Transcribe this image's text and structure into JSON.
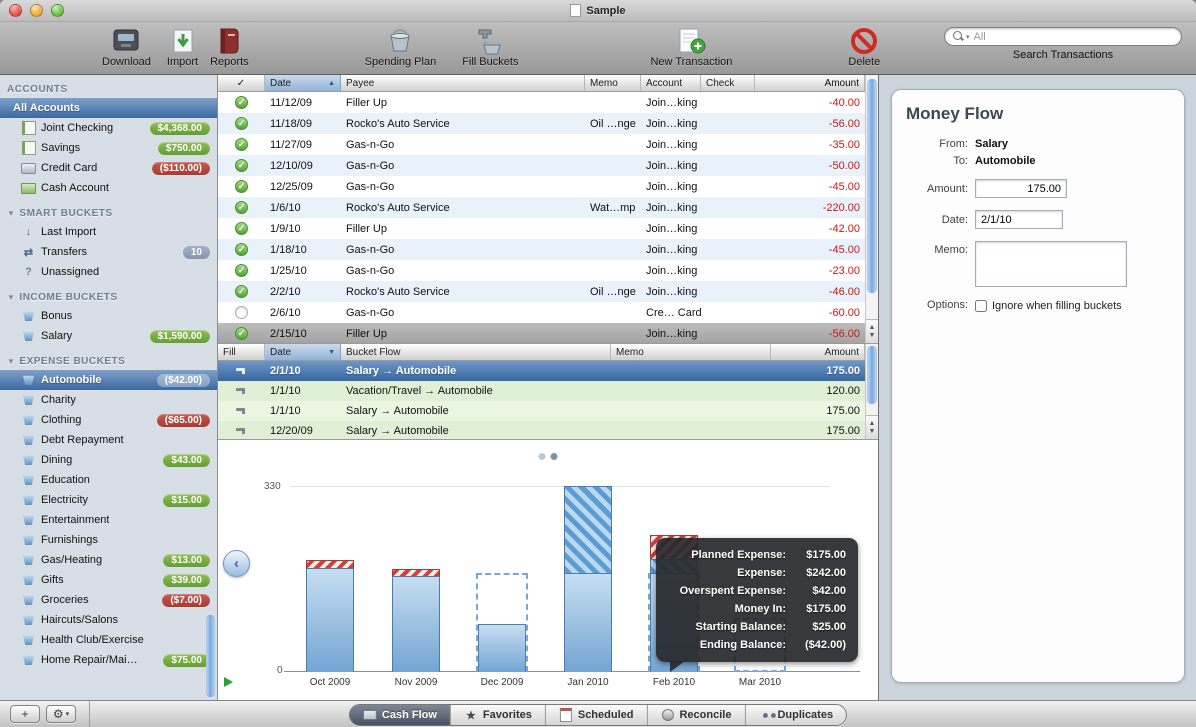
{
  "window": {
    "title": "Sample"
  },
  "toolbar": {
    "buttons": [
      {
        "label": "Download",
        "icon": "download-icon"
      },
      {
        "label": "Import",
        "icon": "import-icon"
      },
      {
        "label": "Reports",
        "icon": "reports-icon"
      },
      {
        "label": "Spending Plan",
        "icon": "spending-plan-icon"
      },
      {
        "label": "Fill Buckets",
        "icon": "fill-buckets-icon"
      },
      {
        "label": "New Transaction",
        "icon": "new-transaction-icon"
      },
      {
        "label": "Delete",
        "icon": "delete-icon"
      }
    ],
    "search": {
      "placeholder": "All",
      "label": "Search Transactions"
    }
  },
  "sidebar": {
    "sections": [
      {
        "title": "ACCOUNTS",
        "disclosure": false,
        "items": [
          {
            "label": "All Accounts",
            "selected": true
          },
          {
            "label": "Joint Checking",
            "icon": "account-icon",
            "badge": "$4,368.00",
            "badge_color": "green"
          },
          {
            "label": "Savings",
            "icon": "account-icon",
            "badge": "$750.00",
            "badge_color": "green"
          },
          {
            "label": "Credit Card",
            "icon": "card-icon",
            "badge": "($110.00)",
            "badge_color": "red"
          },
          {
            "label": "Cash Account",
            "icon": "cash-icon"
          }
        ]
      },
      {
        "title": "SMART BUCKETS",
        "disclosure": true,
        "items": [
          {
            "label": "Last Import",
            "icon": "import-bucket-icon"
          },
          {
            "label": "Transfers",
            "icon": "transfer-icon",
            "badge": "10",
            "badge_color": "gray"
          },
          {
            "label": "Unassigned",
            "icon": "unassigned-icon"
          }
        ]
      },
      {
        "title": "INCOME BUCKETS",
        "disclosure": true,
        "items": [
          {
            "label": "Bonus",
            "icon": "bucket-icon"
          },
          {
            "label": "Salary",
            "icon": "bucket-icon",
            "badge": "$1,590.00",
            "badge_color": "green"
          }
        ]
      },
      {
        "title": "EXPENSE BUCKETS",
        "disclosure": true,
        "items": [
          {
            "label": "Automobile",
            "icon": "bucket-icon",
            "selected": true,
            "badge": "($42.00)",
            "badge_color": "white"
          },
          {
            "label": "Charity",
            "icon": "bucket-icon"
          },
          {
            "label": "Clothing",
            "icon": "bucket-icon",
            "badge": "($65.00)",
            "badge_color": "red"
          },
          {
            "label": "Debt Repayment",
            "icon": "bucket-icon"
          },
          {
            "label": "Dining",
            "icon": "bucket-icon",
            "badge": "$43.00",
            "badge_color": "green"
          },
          {
            "label": "Education",
            "icon": "bucket-icon"
          },
          {
            "label": "Electricity",
            "icon": "bucket-icon",
            "badge": "$15.00",
            "badge_color": "green"
          },
          {
            "label": "Entertainment",
            "icon": "bucket-icon"
          },
          {
            "label": "Furnishings",
            "icon": "bucket-icon"
          },
          {
            "label": "Gas/Heating",
            "icon": "bucket-icon",
            "badge": "$13.00",
            "badge_color": "green"
          },
          {
            "label": "Gifts",
            "icon": "bucket-icon",
            "badge": "$39.00",
            "badge_color": "green"
          },
          {
            "label": "Groceries",
            "icon": "bucket-icon",
            "badge": "($7.00)",
            "badge_color": "red"
          },
          {
            "label": "Haircuts/Salons",
            "icon": "bucket-icon"
          },
          {
            "label": "Health Club/Exercise",
            "icon": "bucket-icon"
          },
          {
            "label": "Home Repair/Mai…",
            "icon": "bucket-icon",
            "badge": "$75.00",
            "badge_color": "green"
          }
        ]
      }
    ]
  },
  "transactions": {
    "columns": [
      "✓",
      "Date",
      "Payee",
      "Memo",
      "Account",
      "Check",
      "Amount"
    ],
    "sort_column": "Date",
    "sort_direction": "asc",
    "rows": [
      {
        "date": "11/12/09",
        "payee": "Filler Up",
        "memo": "",
        "account": "Join…king",
        "check": "",
        "amount": "-40.00",
        "status": "cleared"
      },
      {
        "date": "11/18/09",
        "payee": "Rocko's Auto Service",
        "memo": "Oil …nge",
        "account": "Join…king",
        "check": "",
        "amount": "-56.00",
        "status": "cleared"
      },
      {
        "date": "11/27/09",
        "payee": "Gas-n-Go",
        "memo": "",
        "account": "Join…king",
        "check": "",
        "amount": "-35.00",
        "status": "cleared"
      },
      {
        "date": "12/10/09",
        "payee": "Gas-n-Go",
        "memo": "",
        "account": "Join…king",
        "check": "",
        "amount": "-50.00",
        "status": "cleared"
      },
      {
        "date": "12/25/09",
        "payee": "Gas-n-Go",
        "memo": "",
        "account": "Join…king",
        "check": "",
        "amount": "-45.00",
        "status": "cleared"
      },
      {
        "date": "1/6/10",
        "payee": "Rocko's Auto Service",
        "memo": "Wat…mp",
        "account": "Join…king",
        "check": "",
        "amount": "-220.00",
        "status": "cleared"
      },
      {
        "date": "1/9/10",
        "payee": "Filler Up",
        "memo": "",
        "account": "Join…king",
        "check": "",
        "amount": "-42.00",
        "status": "cleared"
      },
      {
        "date": "1/18/10",
        "payee": "Gas-n-Go",
        "memo": "",
        "account": "Join…king",
        "check": "",
        "amount": "-45.00",
        "status": "cleared"
      },
      {
        "date": "1/25/10",
        "payee": "Gas-n-Go",
        "memo": "",
        "account": "Join…king",
        "check": "",
        "amount": "-23.00",
        "status": "cleared"
      },
      {
        "date": "2/2/10",
        "payee": "Rocko's Auto Service",
        "memo": "Oil …nge",
        "account": "Join…king",
        "check": "",
        "amount": "-46.00",
        "status": "cleared"
      },
      {
        "date": "2/6/10",
        "payee": "Gas-n-Go",
        "memo": "",
        "account": "Cre… Card",
        "check": "",
        "amount": "-60.00",
        "status": "pending"
      },
      {
        "date": "2/15/10",
        "payee": "Filler Up",
        "memo": "",
        "account": "Join…king",
        "check": "",
        "amount": "-56.00",
        "status": "cleared",
        "selected": true
      }
    ]
  },
  "fills": {
    "columns": [
      "Fill",
      "Date",
      "Bucket Flow",
      "Memo",
      "Amount"
    ],
    "sort_column": "Date",
    "sort_direction": "desc",
    "rows": [
      {
        "date": "2/1/10",
        "flow": "Salary → Automobile",
        "memo": "",
        "amount": "175.00",
        "selected": true
      },
      {
        "date": "1/1/10",
        "flow": "Vacation/Travel → Automobile",
        "memo": "",
        "amount": "120.00"
      },
      {
        "date": "1/1/10",
        "flow": "Salary → Automobile",
        "memo": "",
        "amount": "175.00"
      },
      {
        "date": "12/20/09",
        "flow": "Salary → Automobile",
        "memo": "",
        "amount": "175.00"
      }
    ]
  },
  "chart_data": {
    "type": "bar",
    "title": "Automobile bucket cash flow by month",
    "x": [
      "Oct 2009",
      "Nov 2009",
      "Dec 2009",
      "Jan 2010",
      "Feb 2010",
      "Mar 2010"
    ],
    "ylim": [
      0,
      330
    ],
    "yticks": [
      "330",
      "0"
    ],
    "series": [
      {
        "name": "money_in",
        "values": [
          185,
          171,
          85,
          175,
          175,
          0
        ]
      },
      {
        "name": "from_balance",
        "values": [
          0,
          0,
          0,
          155,
          25,
          0
        ]
      },
      {
        "name": "overspent",
        "values": [
          15,
          12,
          0,
          0,
          42,
          0
        ]
      },
      {
        "name": "planned",
        "values": [
          0,
          0,
          175,
          0,
          175,
          95
        ]
      }
    ],
    "pager_dots": 2,
    "active_dot": 2,
    "tooltip": {
      "month": "Feb 2010",
      "rows": [
        {
          "label": "Planned Expense:",
          "value": "$175.00"
        },
        {
          "label": "Expense:",
          "value": "$242.00"
        },
        {
          "label": "Overspent Expense:",
          "value": "$42.00"
        },
        {
          "label": "Money In:",
          "value": "$175.00"
        },
        {
          "label": "Starting Balance:",
          "value": "$25.00"
        },
        {
          "label": "Ending Balance:",
          "value": "($42.00)"
        }
      ]
    }
  },
  "inspector": {
    "title": "Money Flow",
    "from_label": "From:",
    "from_value": "Salary",
    "to_label": "To:",
    "to_value": "Automobile",
    "amount_label": "Amount:",
    "amount_value": "175.00",
    "date_label": "Date:",
    "date_value": "2/1/10",
    "memo_label": "Memo:",
    "options_label": "Options:",
    "options_checkbox": "Ignore when filling buckets"
  },
  "tabbar": {
    "tabs": [
      {
        "label": "Cash Flow",
        "icon": "cash-flow-icon",
        "selected": true
      },
      {
        "label": "Favorites",
        "icon": "star-icon"
      },
      {
        "label": "Scheduled",
        "icon": "calendar-icon"
      },
      {
        "label": "Reconcile",
        "icon": "reconcile-icon"
      },
      {
        "label": "Duplicates",
        "icon": "duplicates-icon"
      }
    ]
  }
}
